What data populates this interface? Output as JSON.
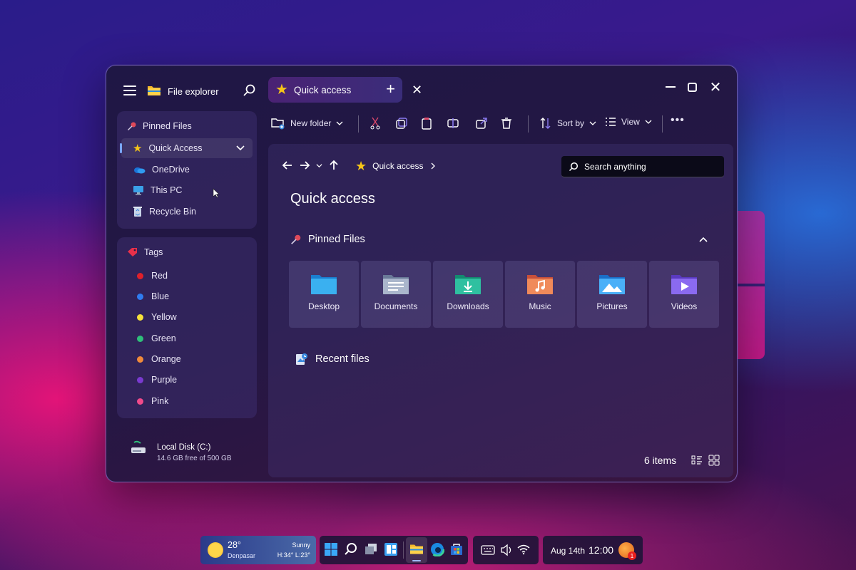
{
  "app": {
    "title": "File explorer"
  },
  "tab": {
    "label": "Quick access"
  },
  "sidebar": {
    "top_section": {
      "heading": "Pinned Files",
      "items": [
        {
          "label": "Quick Access",
          "icon": "star-icon"
        },
        {
          "label": "OneDrive",
          "icon": "cloud-icon"
        },
        {
          "label": "This PC",
          "icon": "monitor-icon"
        },
        {
          "label": "Recycle Bin",
          "icon": "recycle-bin-icon"
        }
      ]
    },
    "tags": {
      "heading": "Tags",
      "items": [
        {
          "label": "Red",
          "color": "#e0202a"
        },
        {
          "label": "Blue",
          "color": "#2f7cf0"
        },
        {
          "label": "Yellow",
          "color": "#f5e13a"
        },
        {
          "label": "Green",
          "color": "#2fbf7a"
        },
        {
          "label": "Orange",
          "color": "#f08a3a"
        },
        {
          "label": "Purple",
          "color": "#7a3ad0"
        },
        {
          "label": "Pink",
          "color": "#f04a8a"
        }
      ]
    },
    "disk": {
      "name": "Local Disk (C:)",
      "free": "14.6 GB free of 500 GB"
    }
  },
  "toolbar": {
    "new_folder": "New folder",
    "sort_by": "Sort by",
    "view": "View"
  },
  "content": {
    "breadcrumb": "Quick access",
    "search_placeholder": "Search anything",
    "page_title": "Quick access",
    "pinned_heading": "Pinned Files",
    "folders": [
      {
        "label": "Desktop",
        "color": "#2a9fe0"
      },
      {
        "label": "Documents",
        "color": "#8a9ab8"
      },
      {
        "label": "Downloads",
        "color": "#1fa88a"
      },
      {
        "label": "Music",
        "color": "#e8784a"
      },
      {
        "label": "Pictures",
        "color": "#3a9ff0"
      },
      {
        "label": "Videos",
        "color": "#7a5ae8"
      }
    ],
    "recent_heading": "Recent files",
    "items_count": "6 items"
  },
  "taskbar": {
    "weather": {
      "temp": "28°",
      "city": "Denpasar",
      "condition": "Sunny",
      "high_low": "H:34° L:23°"
    },
    "date": "Aug 14th",
    "time": "12:00",
    "notification_count": "1"
  }
}
